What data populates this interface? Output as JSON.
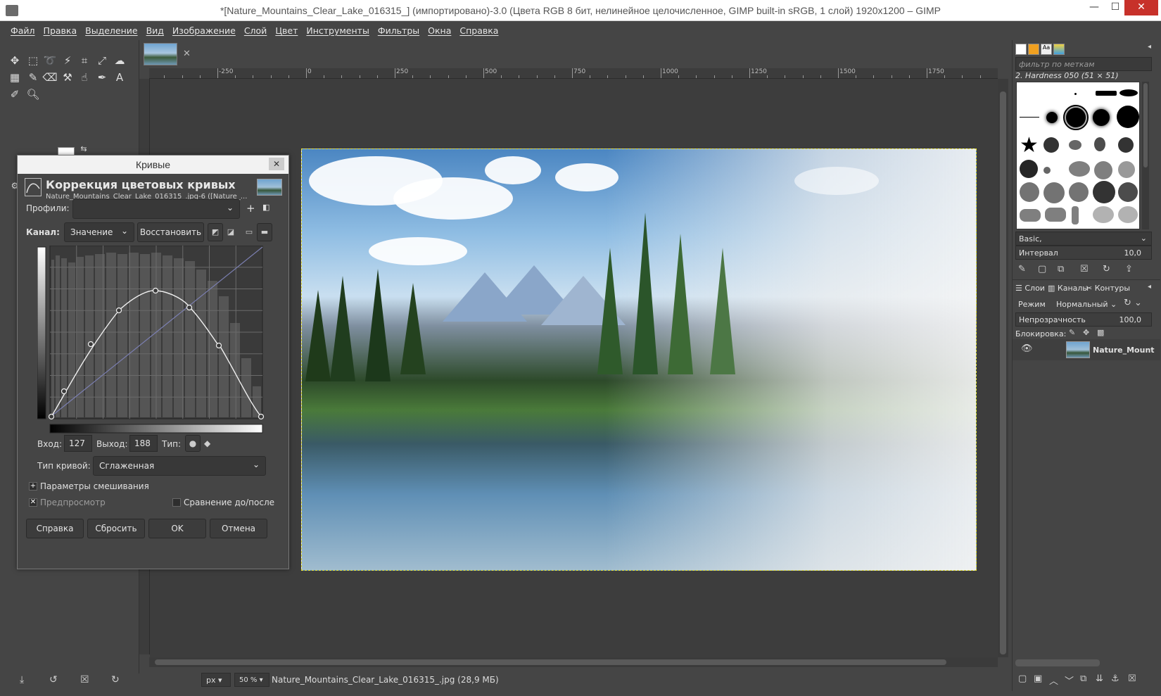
{
  "window": {
    "title": "*[Nature_Mountains_Clear_Lake_016315_] (импортировано)-3.0 (Цвета RGB 8 бит, нелинейное целочисленное, GIMP built-in sRGB, 1 слой) 1920x1200 – GIMP",
    "minimize": "—",
    "maximize": "☐",
    "close": "✕"
  },
  "menu": [
    "Файл",
    "Правка",
    "Выделение",
    "Вид",
    "Изображение",
    "Слой",
    "Цвет",
    "Инструменты",
    "Фильтры",
    "Окна",
    "Справка"
  ],
  "ruler": {
    "labels": [
      "-250",
      "0",
      "250",
      "500",
      "750",
      "1000",
      "1250",
      "1500",
      "1750"
    ]
  },
  "statusbar": {
    "unit": "px",
    "zoom": "50 %",
    "file": "Nature_Mountains_Clear_Lake_016315_.jpg (28,9 МБ)"
  },
  "curves_dialog": {
    "window_title": "Кривые",
    "heading": "Коррекция цветовых кривых",
    "subheading": "Nature_Mountains_Clear_Lake_016315_.jpg-6 ([Nature_...",
    "profiles_label": "Профили:",
    "profiles_value": "",
    "channel_label": "Канал:",
    "channel_value": "Значение",
    "reset_channel": "Восстановить",
    "input_label": "Вход:",
    "input_value": "127",
    "output_label": "Выход:",
    "output_value": "188",
    "type_label": "Тип:",
    "curve_type_label": "Тип кривой:",
    "curve_type_value": "Сглаженная",
    "blend_options": "Параметры смешивания",
    "preview": "Предпросмотр",
    "split_view": "Сравнение до/после",
    "buttons": {
      "help": "Справка",
      "reset": "Сбросить",
      "ok": "OK",
      "cancel": "Отмена"
    }
  },
  "brushes": {
    "filter_placeholder": "фильтр по меткам",
    "selected": "2. Hardness 050 (51 × 51)",
    "tag_value": "Basic,",
    "spacing_label": "Интервал",
    "spacing_value": "10,0"
  },
  "layers": {
    "tabs": [
      "Слои",
      "Каналы",
      "Контуры"
    ],
    "mode_label": "Режим",
    "mode_value": "Нормальный",
    "opacity_label": "Непрозрачность",
    "opacity_value": "100,0",
    "lock_label": "Блокировка:",
    "layer_name": "Nature_Mount"
  }
}
